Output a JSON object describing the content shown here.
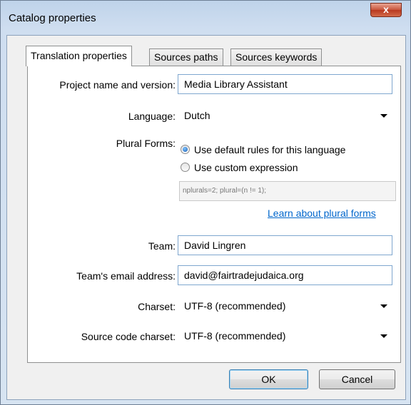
{
  "window": {
    "title": "Catalog properties",
    "close_label": "x"
  },
  "tabs": [
    {
      "label": "Translation properties",
      "active": true
    },
    {
      "label": "Sources paths",
      "active": false
    },
    {
      "label": "Sources keywords",
      "active": false
    }
  ],
  "form": {
    "project_label": "Project name and version:",
    "project_value": "Media Library Assistant",
    "language_label": "Language:",
    "language_value": "Dutch",
    "plural_label": "Plural Forms:",
    "plural_default_label": "Use default rules for this language",
    "plural_custom_label": "Use custom expression",
    "plural_selected": "default",
    "plural_expression": "nplurals=2; plural=(n != 1);",
    "plural_link": "Learn about plural forms",
    "team_label": "Team:",
    "team_value": "David Lingren",
    "email_label": "Team's email address:",
    "email_value": "david@fairtradejudaica.org",
    "charset_label": "Charset:",
    "charset_value": "UTF-8 (recommended)",
    "source_charset_label": "Source code charset:",
    "source_charset_value": "UTF-8 (recommended)"
  },
  "buttons": {
    "ok": "OK",
    "cancel": "Cancel"
  },
  "colors": {
    "link": "#0066cc",
    "close_button": "#c7533a",
    "focus_border": "#7fa7cf"
  }
}
